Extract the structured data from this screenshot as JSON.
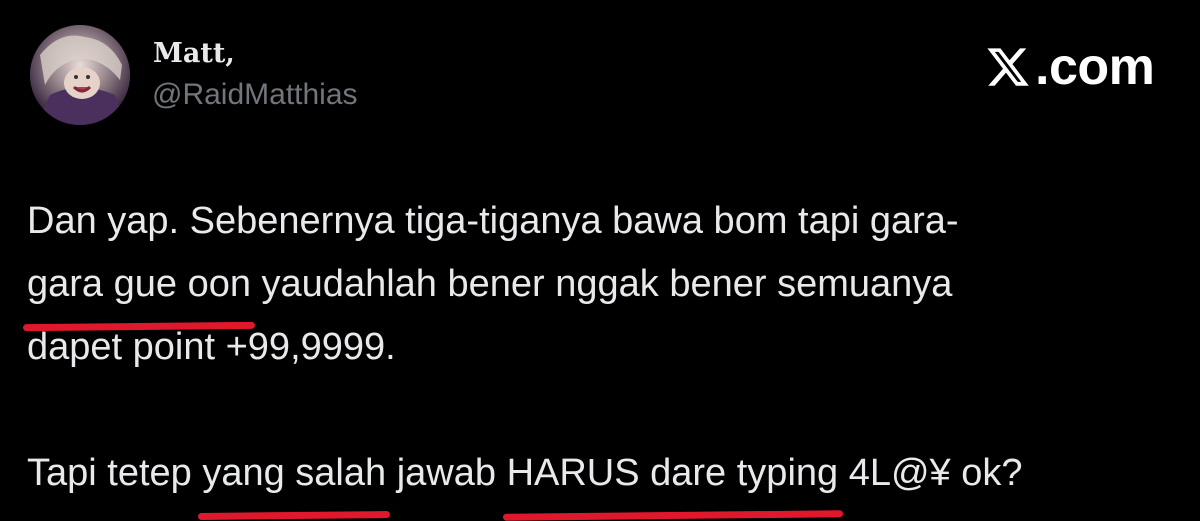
{
  "tweet": {
    "author": {
      "display_name": "Matt,",
      "handle": "@RaidMatthias",
      "avatar": "avatar-illustration"
    },
    "brand": {
      "icon": "x-logo-icon",
      "text": ".com"
    },
    "body": {
      "line1": "Dan yap. Sebenernya tiga-tiganya bawa bom tapi gara-",
      "line2_underlined": "gara gue oon",
      "line2_rest": " yaudahlah bener nggak bener semuanya",
      "line3": "dapet point +99,9999.",
      "line4_start": "Tapi tetep ",
      "line4_underlined1": "yang salah",
      "line4_mid": " jawab ",
      "line4_underlined2": "HARUS dare typing",
      "line4_end": " 4L@¥ ok?"
    }
  },
  "colors": {
    "background": "#000000",
    "text": "#e7e9ea",
    "secondary_text": "#71767b",
    "underline_marker": "#e0182c"
  }
}
